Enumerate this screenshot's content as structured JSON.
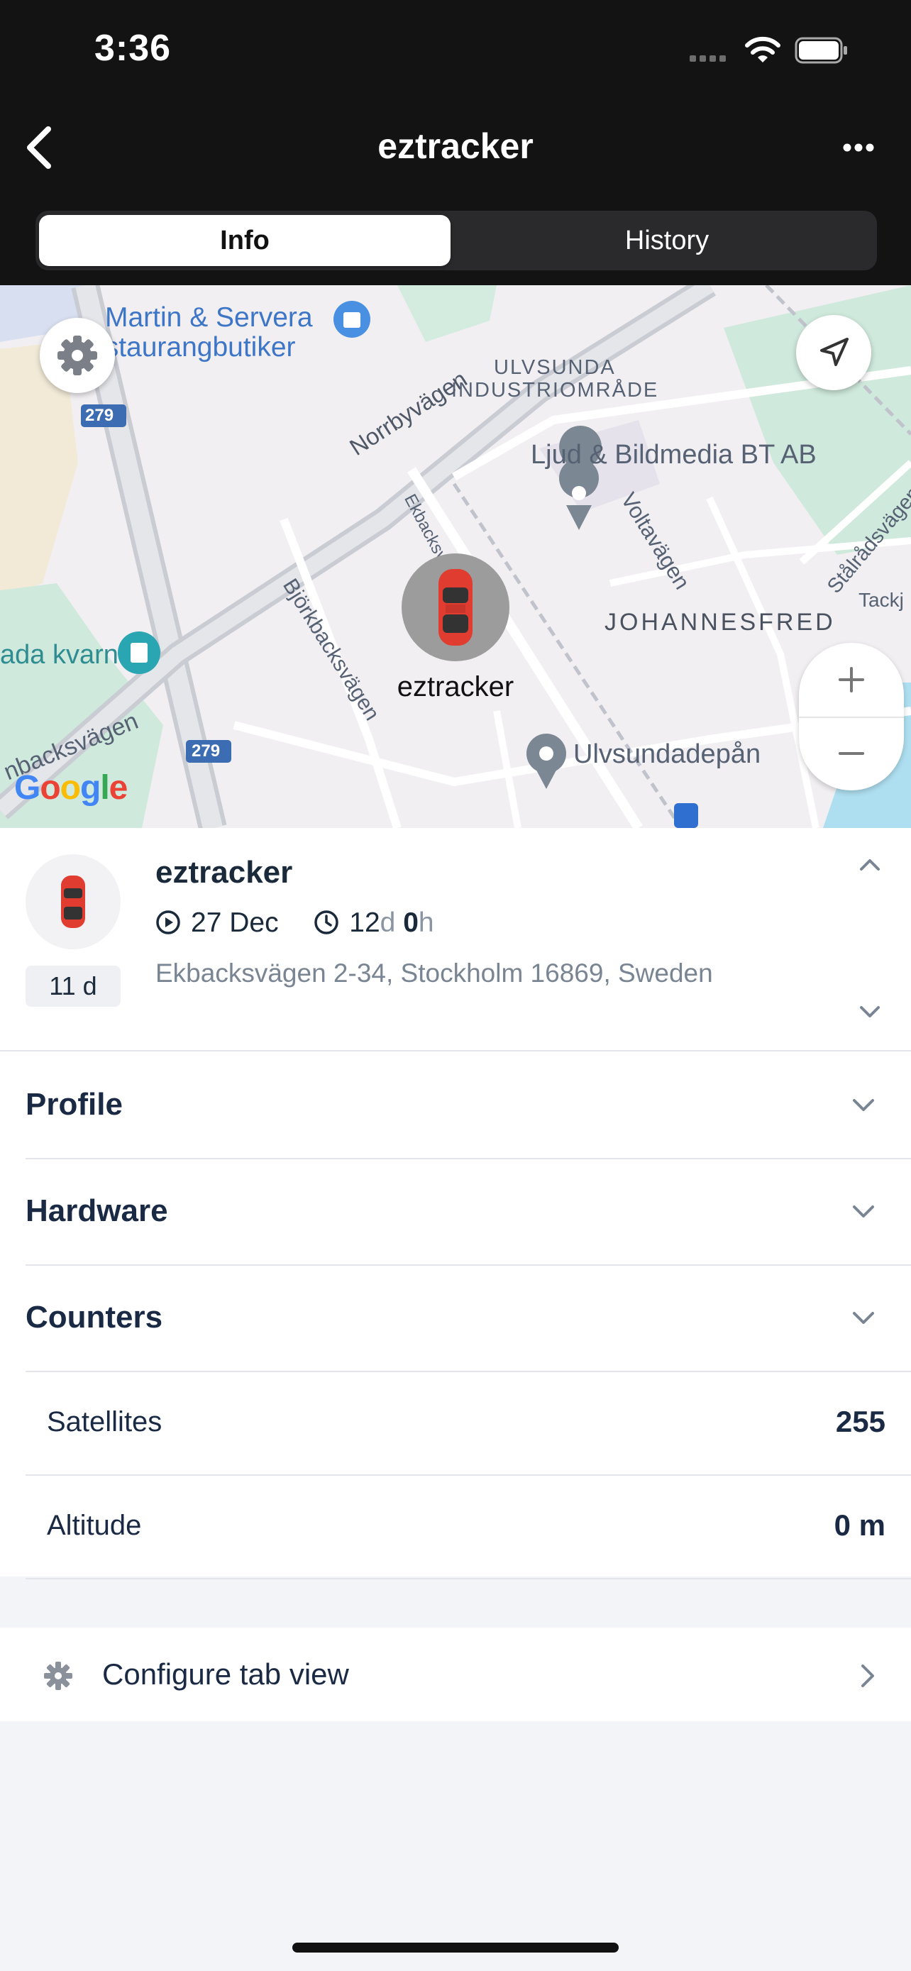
{
  "status_bar": {
    "time": "3:36"
  },
  "nav": {
    "title": "eztracker",
    "back_icon": "chevron-left-icon",
    "more_icon": "ellipsis-icon",
    "tabs": [
      {
        "label": "Info",
        "active": true
      },
      {
        "label": "History",
        "active": false
      }
    ]
  },
  "map": {
    "labels": {
      "martin1": "Martin & Servera",
      "martin2": "estaurangbutiker",
      "ulvsunda1": "ULVSUNDA",
      "ulvsunda2": "INDUSTRIOMRÅDE",
      "ljud": "Ljud & Bildmedia BT AB",
      "norrby": "Norrbyvägen",
      "ekback": "Ekbacksvägen",
      "volta": "Voltavägen",
      "stalrad": "Stålrådsvägen",
      "tackj": "Tackj",
      "johannes": "JOHANNESFRED",
      "bjork": "Björkbacksvägen",
      "kvarn": "ada kvarn",
      "backs": "nbacksvägen",
      "route1": "279",
      "route2": "279",
      "depan": "Ulvsundadepån"
    },
    "marker_label": "eztracker",
    "google_logo": "Google",
    "zoom_in": "+",
    "zoom_out": "−"
  },
  "device": {
    "name": "eztracker",
    "date": "27 Dec",
    "duration_days": "12",
    "duration_days_unit": "d",
    "duration_hours": "0",
    "duration_hours_unit": "h",
    "address": "Ekbacksvägen 2-34, Stockholm 16869, Sweden",
    "age_badge": "11 d"
  },
  "sections": [
    {
      "title": "Profile"
    },
    {
      "title": "Hardware"
    },
    {
      "title": "Counters"
    }
  ],
  "counters": [
    {
      "key": "Satellites",
      "value": "255"
    },
    {
      "key": "Altitude",
      "value": "0 m"
    }
  ],
  "configure": {
    "label": "Configure tab view"
  },
  "colors": {
    "header_bg": "#131313",
    "text_dark": "#1a2a44",
    "accent_marker": "#e33b2e"
  }
}
